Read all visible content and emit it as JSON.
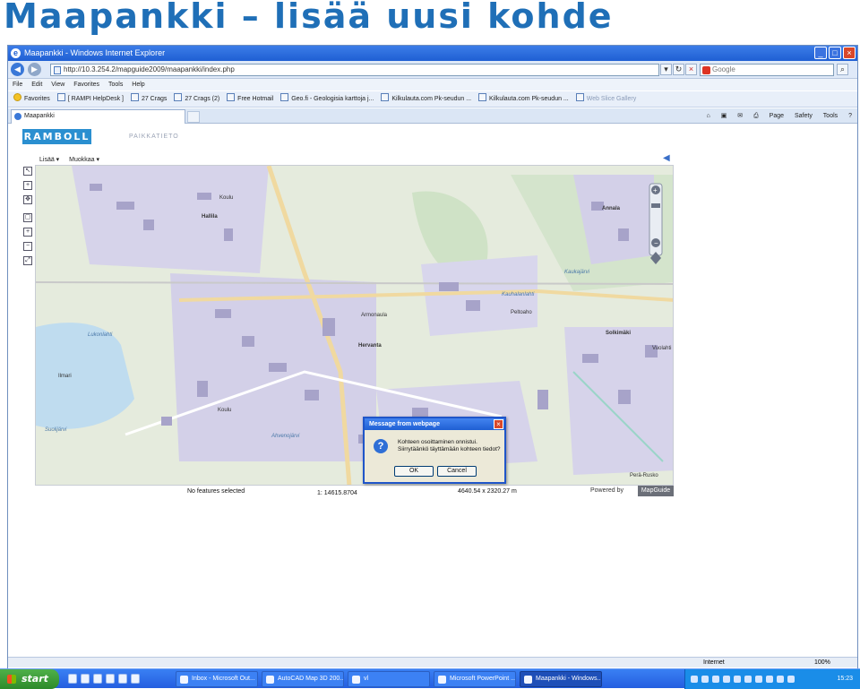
{
  "slide": {
    "title": "Maapankki – lisää uusi kohde"
  },
  "window": {
    "title": "Maapankki - Windows Internet Explorer"
  },
  "address": {
    "url": "http://10.3.254.2/mapguide2009/maapankki/index.php",
    "search_placeholder": "Google"
  },
  "menu": [
    "File",
    "Edit",
    "View",
    "Favorites",
    "Tools",
    "Help"
  ],
  "favorites": {
    "label": "Favorites",
    "items": [
      "[ RAMPI HelpDesk ]",
      "27 Crags",
      "27 Crags (2)",
      "Free Hotmail",
      "Geo.fi - Geologisia karttoja j...",
      "Kilkulauta.com Pk-seudun ...",
      "Kilkulauta.com Pk-seudun ...",
      "Web Slice Gallery"
    ]
  },
  "tab": {
    "label": "Maapankki"
  },
  "commandbar": [
    "Page",
    "Safety",
    "Tools"
  ],
  "app": {
    "logo": "RAMBOLL",
    "brand_sub": "PAIKKATIETO",
    "menu": [
      "Lisää ▾",
      "Muokkaa ▾"
    ]
  },
  "map_labels": [
    {
      "text": "Koulu"
    },
    {
      "text": "Hallila"
    },
    {
      "text": "Hervanta"
    },
    {
      "text": "Annala"
    },
    {
      "text": "Lukonlahti"
    },
    {
      "text": "Ilmari"
    },
    {
      "text": "Suolijärvi"
    },
    {
      "text": "Koulu"
    },
    {
      "text": "Armonaula"
    },
    {
      "text": "Solkimäki"
    },
    {
      "text": "Vuolahti"
    },
    {
      "text": "Peltoaho"
    },
    {
      "text": "Ahvenojärvi"
    },
    {
      "text": "Perä-Rusko"
    },
    {
      "text": "Kauhalanlahti"
    },
    {
      "text": "Kaukajärvi"
    }
  ],
  "status": {
    "selection": "No features selected",
    "scale": "1: 14615.8704",
    "size": "4640.54 x 2320.27 m",
    "powered": "Powered by",
    "mapguide": "MapGuide"
  },
  "dialog": {
    "title": "Message from webpage",
    "line1": "Kohteen osoittaminen onnistui.",
    "line2": "Siirrytäänkö täyttämään kohteen tiedot?",
    "ok": "OK",
    "cancel": "Cancel"
  },
  "ie_status": {
    "zone": "Internet",
    "zoom": "100%"
  },
  "taskbar": {
    "start": "start",
    "tasks": [
      "Inbox - Microsoft Out...",
      "AutoCAD Map 3D 200...",
      "vl",
      "Microsoft PowerPoint ...",
      "Maapankki - Windows..."
    ],
    "time": "15:23"
  }
}
